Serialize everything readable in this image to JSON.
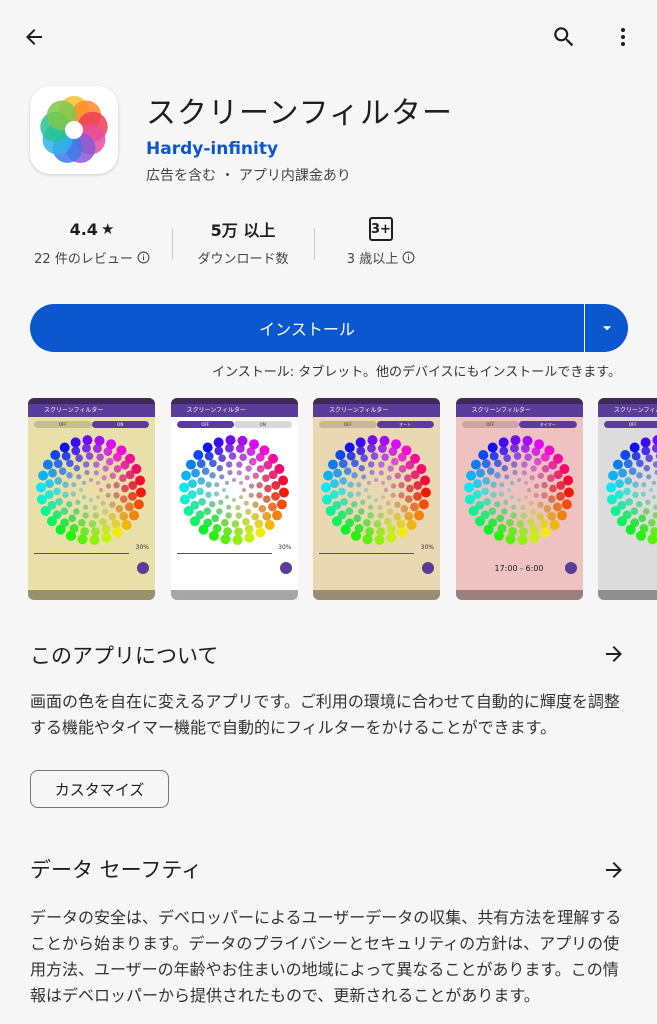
{
  "topbar": {
    "back_icon": "arrow-back-icon",
    "search_icon": "search-icon",
    "menu_icon": "more-vert-icon"
  },
  "app": {
    "title": "スクリーンフィルター",
    "developer": "Hardy-infinity",
    "ad_note": "広告を含む ・ アプリ内課金あり",
    "icon_colors": [
      "#f6c12e",
      "#ff8a2a",
      "#ef3d57",
      "#e64fa0",
      "#8a58d6",
      "#3b7be8",
      "#2cb6e6",
      "#27c28f",
      "#7cc84b"
    ]
  },
  "stats": {
    "rating": {
      "value": "4.4",
      "label": "22 件のレビュー"
    },
    "downloads": {
      "value": "5万 以上",
      "label": "ダウンロード数"
    },
    "age": {
      "value": "3+",
      "label": "3 歳以上"
    }
  },
  "install": {
    "label": "インストール",
    "note": "インストール: タブレット。他のデバイスにもインストールできます。",
    "color": "#0b57d0"
  },
  "screenshots": [
    {
      "bg": "#e8e0a8",
      "title": "スクリーンフィルター",
      "toggle": [
        "OFF",
        "ON"
      ],
      "active": 1,
      "percent": "30%",
      "time": ""
    },
    {
      "bg": "#ffffff",
      "title": "スクリーンフィルター",
      "toggle": [
        "OFF",
        "ON"
      ],
      "active": 0,
      "percent": "30%",
      "time": ""
    },
    {
      "bg": "#ead8b3",
      "title": "スクリーンフィルター",
      "toggle": [
        "OFF",
        "オート"
      ],
      "active": 1,
      "percent": "30%",
      "time": ""
    },
    {
      "bg": "#efc2c2",
      "title": "スクリーンフィルター",
      "toggle": [
        "OFF",
        "タイマー"
      ],
      "active": 1,
      "percent": "",
      "time": "17:00 - 6:00"
    },
    {
      "bg": "#dcdcdc",
      "title": "スクリーンフィルタ",
      "toggle": [
        "OFF",
        ""
      ],
      "active": 0,
      "percent": "",
      "time": ""
    }
  ],
  "about": {
    "title": "このアプリについて",
    "description": "画面の色を自在に変えるアプリです。ご利用の環境に合わせて自動的に輝度を調整する機能やタイマー機能で自動的にフィルターをかけることができます。",
    "chip": "カスタマイズ"
  },
  "safety": {
    "title": "データ セーフティ",
    "description": "データの安全は、デベロッパーによるユーザーデータの収集、共有方法を理解することから始まります。データのプライバシーとセキュリティの方針は、アプリの使用方法、ユーザーの年齢やお住まいの地域によって異なることがあります。この情報はデベロッパーから提供されたもので、更新されることがあります。"
  }
}
